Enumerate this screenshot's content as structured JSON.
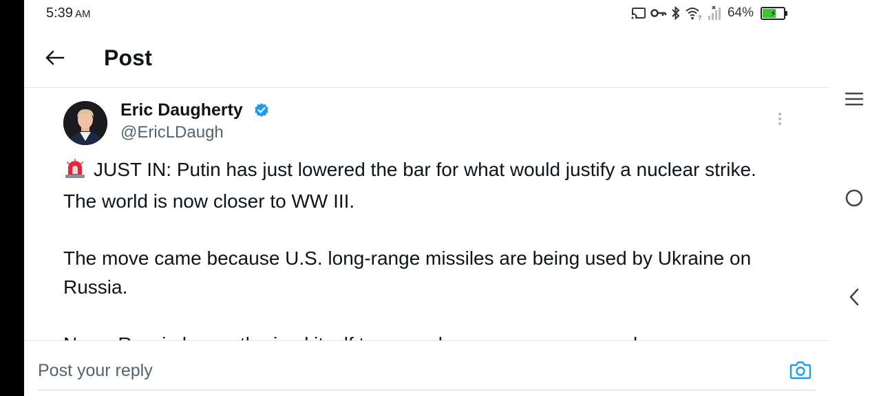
{
  "status_bar": {
    "time": "5:39",
    "ampm": "AM",
    "battery_percent": "64%",
    "battery_level": 0.64,
    "icons": [
      "cast-icon",
      "vpn-key-icon",
      "bluetooth-icon",
      "wifi-icon",
      "cellular-signal-icon",
      "battery-icon"
    ]
  },
  "header": {
    "title": "Post",
    "back_icon": "arrow-left-icon"
  },
  "post": {
    "author_name": "Eric Daugherty",
    "author_handle": "@EricLDaugh",
    "verified": true,
    "verified_color": "#1d9bf0",
    "paragraphs": [
      "JUST IN: Putin has just lowered the bar for what would justify a nuclear strike. The world is now closer to WW III.",
      "The move came because U.S. long-range missiles are being used by Ukraine on Russia.",
      "Now , Russia has authorized itself to use nukes even on a non-nuclear"
    ],
    "lead_emoji": "police-siren-icon"
  },
  "reply": {
    "placeholder": "Post your reply",
    "camera_icon": "camera-icon",
    "accent_color": "#1d9bf0"
  },
  "system_nav": {
    "icons": [
      "menu-icon",
      "home-circle-icon",
      "back-chevron-icon"
    ]
  }
}
